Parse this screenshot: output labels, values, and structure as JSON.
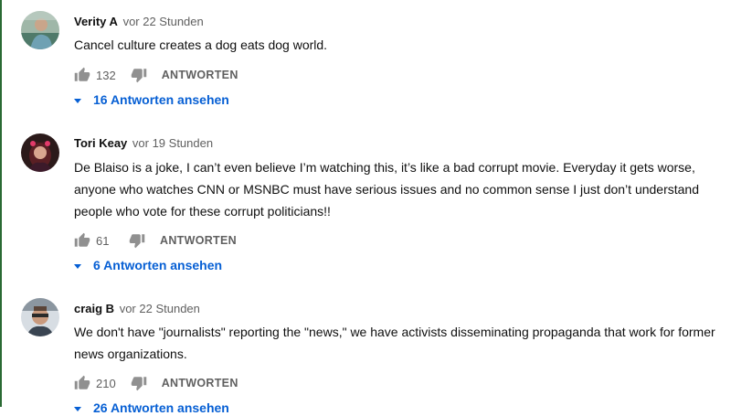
{
  "comments": [
    {
      "author": "Verity A",
      "time": "vor 22 Stunden",
      "text": "Cancel culture creates a dog eats dog world.",
      "likes": "132",
      "reply_label": "ANTWORTEN",
      "replies_label": "16 Antworten ansehen"
    },
    {
      "author": "Tori Keay",
      "time": "vor 19 Stunden",
      "text": "De Blaiso is a joke, I can’t even believe I’m watching this, it’s like a bad corrupt movie. Everyday it gets worse, anyone who watches CNN or MSNBC must have serious issues and no common sense I just don’t understand people who vote for these corrupt politicians!!",
      "likes": "61",
      "reply_label": "ANTWORTEN",
      "replies_label": "6 Antworten ansehen"
    },
    {
      "author": "craig B",
      "time": "vor 22 Stunden",
      "text": "We don't have \"journalists\" reporting the \"news,\" we have activists disseminating propaganda that work for former news organizations.",
      "likes": "210",
      "reply_label": "ANTWORTEN",
      "replies_label": "26 Antworten ansehen"
    }
  ],
  "icons": {
    "like": "thumbs-up-icon",
    "dislike": "thumbs-down-icon",
    "expand": "caret-down-icon"
  },
  "colors": {
    "link": "#065fd4",
    "secondary_text": "#606060",
    "icon": "#909090"
  }
}
